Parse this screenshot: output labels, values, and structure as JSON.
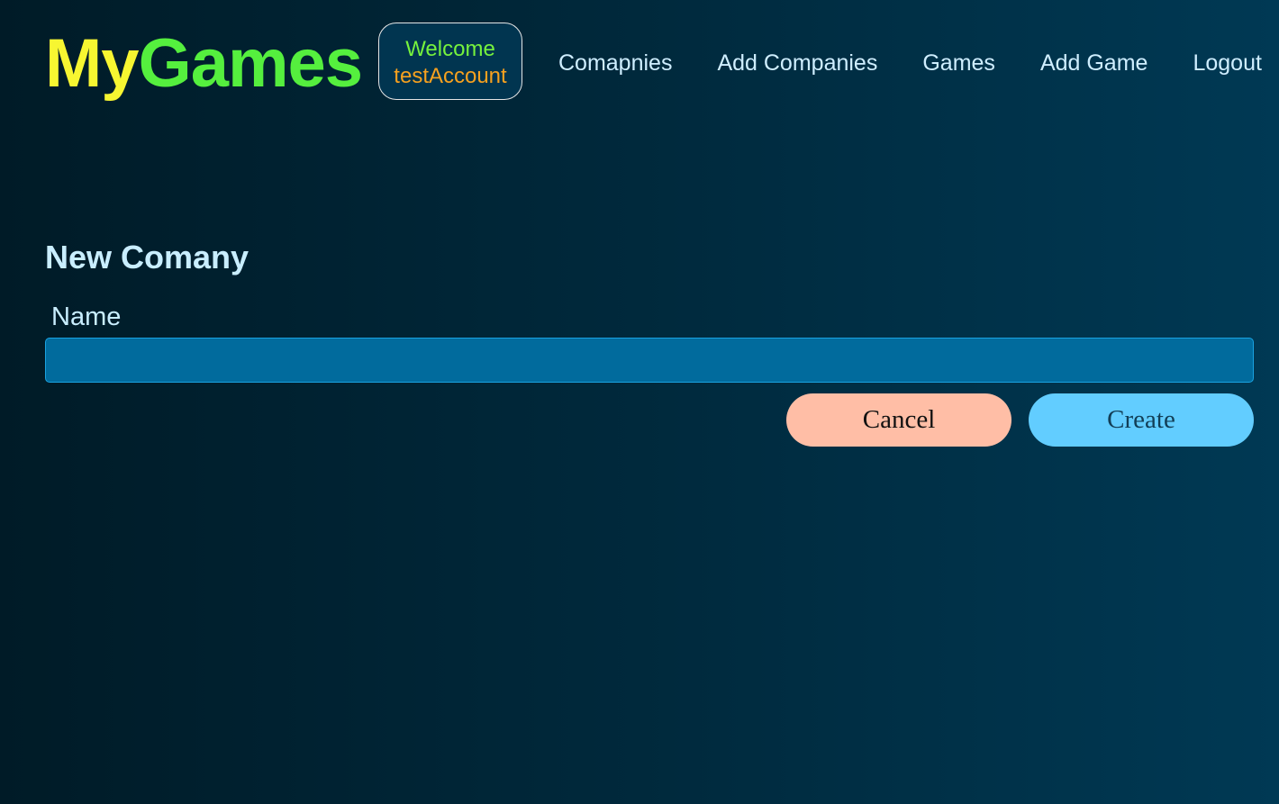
{
  "brand": {
    "part1": "My",
    "part2": "Games"
  },
  "welcome": {
    "line1": "Welcome",
    "username": "testAccount"
  },
  "nav": {
    "items": [
      {
        "label": "Comapnies"
      },
      {
        "label": "Add Companies"
      },
      {
        "label": "Games"
      },
      {
        "label": "Add Game"
      },
      {
        "label": "Logout"
      }
    ]
  },
  "form": {
    "title": "New Comany",
    "name_label": "Name",
    "name_value": "",
    "cancel_label": "Cancel",
    "create_label": "Create"
  },
  "colors": {
    "brand_my": "#f7f631",
    "brand_games": "#55ef3e",
    "welcome_text": "#76f23d",
    "username_text": "#f7a11f",
    "input_bg": "#016b9d",
    "cancel_bg": "#ffbea6",
    "create_bg": "#62cdff"
  }
}
